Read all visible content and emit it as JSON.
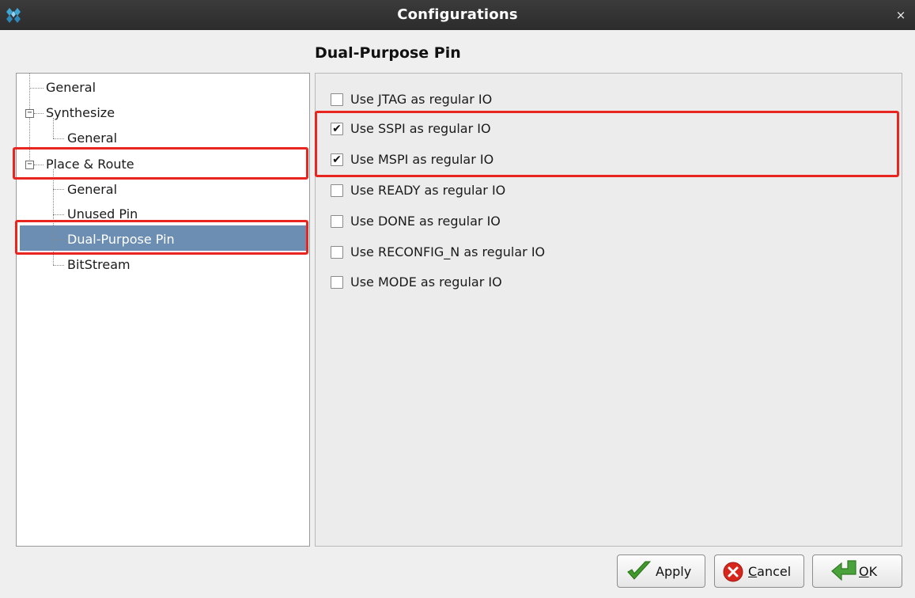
{
  "window": {
    "title": "Configurations",
    "close_glyph": "×",
    "app_icon": "diamond-logo-icon"
  },
  "page_title": "Dual-Purpose Pin",
  "tree": {
    "items": [
      {
        "label": "General",
        "level": 0,
        "expander": null,
        "selected": false
      },
      {
        "label": "Synthesize",
        "level": 0,
        "expander": "⊟",
        "selected": false
      },
      {
        "label": "General",
        "level": 1,
        "expander": null,
        "selected": false
      },
      {
        "label": "Place & Route",
        "level": 0,
        "expander": "⊟",
        "selected": false
      },
      {
        "label": "General",
        "level": 1,
        "expander": null,
        "selected": false
      },
      {
        "label": "Unused Pin",
        "level": 1,
        "expander": null,
        "selected": false
      },
      {
        "label": "Dual-Purpose Pin",
        "level": 1,
        "expander": null,
        "selected": true
      },
      {
        "label": "BitStream",
        "level": 1,
        "expander": null,
        "selected": false
      }
    ],
    "selected_color": "#6b8eb2"
  },
  "options": [
    {
      "label": "Use JTAG as regular IO",
      "checked": false
    },
    {
      "label": "Use SSPI as regular IO",
      "checked": true
    },
    {
      "label": "Use MSPI as regular IO",
      "checked": true
    },
    {
      "label": "Use READY as regular IO",
      "checked": false
    },
    {
      "label": "Use DONE as regular IO",
      "checked": false
    },
    {
      "label": "Use RECONFIG_N as regular IO",
      "checked": false
    },
    {
      "label": "Use MODE as regular IO",
      "checked": false
    }
  ],
  "check_glyph": "✔",
  "buttons": {
    "apply": {
      "label": "Apply",
      "icon": "green-checkmark-icon"
    },
    "cancel": {
      "label_pre": "",
      "label_mnemonic": "C",
      "label_post": "ancel",
      "icon": "red-x-icon"
    },
    "ok": {
      "label_pre": "",
      "label_mnemonic": "O",
      "label_post": "K",
      "icon": "green-enter-arrow-icon"
    }
  },
  "annotation_color": "#e8261f"
}
